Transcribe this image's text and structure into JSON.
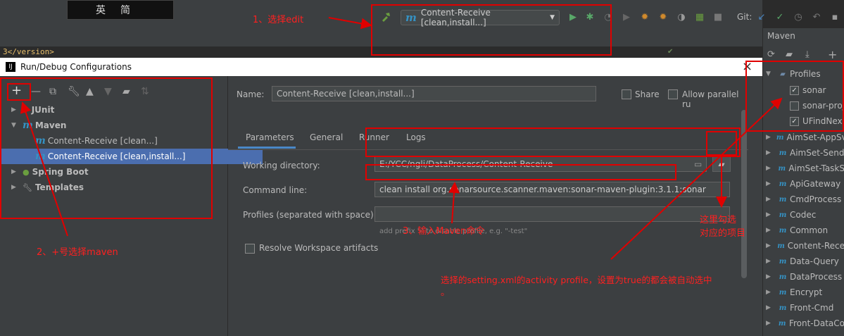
{
  "ime": {
    "char1": "英",
    "char2": "简"
  },
  "code_snippet": "3</version>",
  "toolbar": {
    "run_config_label": "Content-Receive [clean,install...]",
    "git_label": "Git:"
  },
  "maven_panel": {
    "title": "Maven",
    "profiles_label": "Profiles",
    "profiles": [
      {
        "label": "sonar",
        "checked": true
      },
      {
        "label": "sonar-proj",
        "checked": false
      },
      {
        "label": "UFindNex",
        "checked": true
      }
    ],
    "projects": [
      "AimSet-AppSv",
      "AimSet-Send",
      "AimSet-TaskS",
      "ApiGateway",
      "CmdProcess",
      "Codec",
      "Common",
      "Content-Rece",
      "Data-Query",
      "DataProcess",
      "Encrypt",
      "Front-Cmd",
      "Front-DataCo"
    ]
  },
  "dialog": {
    "title": "Run/Debug Configurations",
    "close_symbol": "×",
    "tree": {
      "junit": "JUnit",
      "maven": "Maven",
      "maven_children": [
        "Content-Receive [clean...]",
        "Content-Receive [clean,install...]"
      ],
      "spring_boot": "Spring Boot",
      "templates": "Templates"
    },
    "name_label": "Name:",
    "name_value": "Content-Receive [clean,install...]",
    "share_label": "Share",
    "parallel_label": "Allow parallel ru",
    "tabs": [
      "Parameters",
      "General",
      "Runner",
      "Logs"
    ],
    "working_dir_label": "Working directory:",
    "working_dir_value": "E:/YCC/ngli/DataProcess/Content-Receive",
    "command_line_label": "Command line:",
    "command_line_value": "clean install org.sonarsource.scanner.maven:sonar-maven-plugin:3.1.1:sonar",
    "profiles_label": "Profiles (separated with space):",
    "profiles_value": "",
    "profiles_hint": "add prefix '-' to disable profile, e.g. \"-test\"",
    "resolve_label": "Resolve Workspace artifacts"
  },
  "annotations": {
    "step1": "1、选择edit",
    "step2": "2、+号选择maven",
    "step3": "3、输入Maven命令",
    "note_profile_1": "这里勾选",
    "note_profile_2": "对应的项目",
    "note_activity": "选择的setting.xml的activity profile，设置为true的都会被自动选中",
    "note_activity_dot": "。"
  },
  "colors": {
    "annotation": "#ff2020",
    "selection": "#4b6eaf",
    "maven_icon": "#3592c4"
  }
}
